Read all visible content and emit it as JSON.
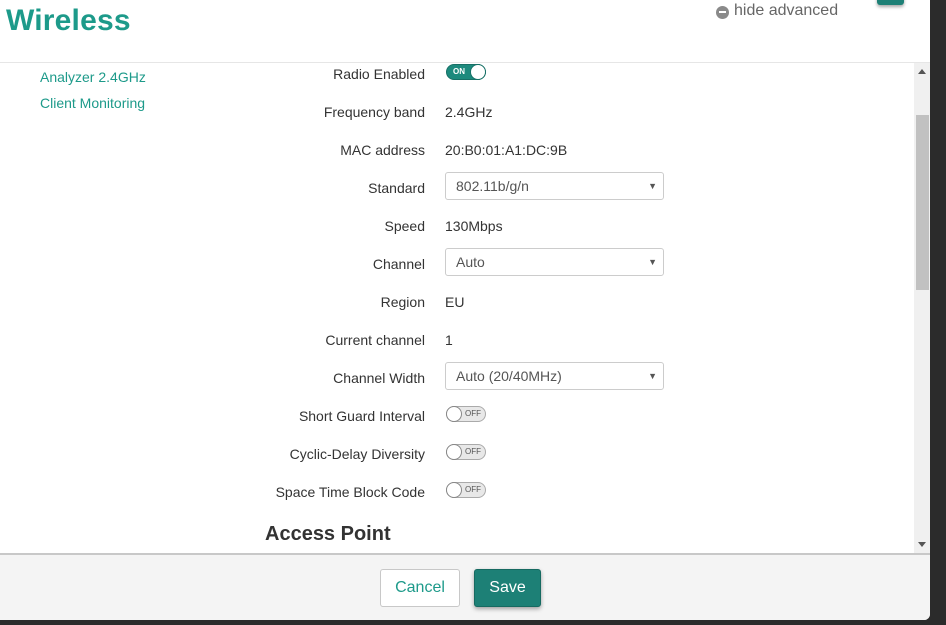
{
  "header": {
    "title": "Wireless",
    "hide_advanced_label": "hide advanced"
  },
  "sidenav": {
    "items": [
      {
        "label": "Analyzer 2.4GHz"
      },
      {
        "label": "Client Monitoring"
      }
    ]
  },
  "form": {
    "radio_enabled": {
      "label": "Radio Enabled",
      "state": "ON"
    },
    "frequency_band": {
      "label": "Frequency band",
      "value": "2.4GHz"
    },
    "mac_address": {
      "label": "MAC address",
      "value": "20:B0:01:A1:DC:9B"
    },
    "standard": {
      "label": "Standard",
      "selected": "802.11b/g/n"
    },
    "speed": {
      "label": "Speed",
      "value": "130Mbps"
    },
    "channel": {
      "label": "Channel",
      "selected": "Auto"
    },
    "region": {
      "label": "Region",
      "value": "EU"
    },
    "current_channel": {
      "label": "Current channel",
      "value": "1"
    },
    "channel_width": {
      "label": "Channel Width",
      "selected": "Auto (20/40MHz)"
    },
    "short_guard_interval": {
      "label": "Short Guard Interval",
      "state": "OFF"
    },
    "cyclic_delay_diversity": {
      "label": "Cyclic-Delay Diversity",
      "state": "OFF"
    },
    "space_time_block_code": {
      "label": "Space Time Block Code",
      "state": "OFF"
    }
  },
  "sections": {
    "access_point_title": "Access Point"
  },
  "icons": {
    "caret": "▼"
  },
  "footer": {
    "cancel_label": "Cancel",
    "save_label": "Save"
  },
  "colors": {
    "accent": "#1d9a8a",
    "button_primary": "#1d8076"
  }
}
